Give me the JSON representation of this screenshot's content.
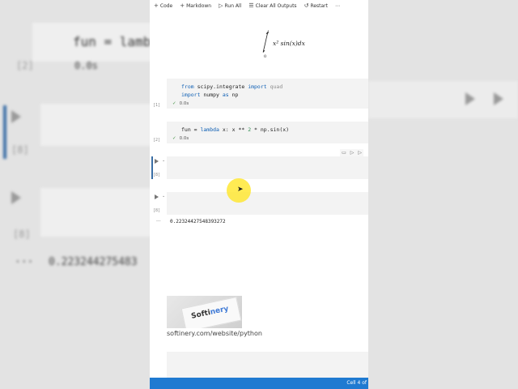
{
  "toolbar": {
    "code": "Code",
    "markdown": "Markdown",
    "run_all": "Run All",
    "clear_outputs": "Clear All Outputs",
    "restart": "Restart",
    "more": "⋯"
  },
  "formula": {
    "upper": "1",
    "lower": "0",
    "integrand": "x² sin(x)dx"
  },
  "cells": [
    {
      "exec": "[1]",
      "line1_a": "from",
      "line1_b": " scipy.integrate ",
      "line1_c": "import",
      "line1_d": " quad",
      "line2_a": "import",
      "line2_b": " numpy ",
      "line2_c": "as",
      "line2_d": " np",
      "status": "0.0s"
    },
    {
      "exec": "[2]",
      "line1_a": "fun = ",
      "line1_b": "lambda",
      "line1_c": " x: x ** ",
      "line1_d": "2",
      "line1_e": " * np.sin(x)",
      "status": "0.0s"
    },
    {
      "exec": "[8]"
    },
    {
      "exec": "[8]",
      "output": "0.22324427548393272"
    }
  ],
  "background": {
    "code": "fun = lamb",
    "num1": "[2]",
    "time": "0.0s",
    "num2": "[8]",
    "num3": "[8]",
    "output": "0.223244275483"
  },
  "promo": {
    "brand_a": "Softi",
    "brand_b": "nery",
    "url": "softinery.com/website/python"
  },
  "statusbar": {
    "text": "Cell 4 of"
  }
}
